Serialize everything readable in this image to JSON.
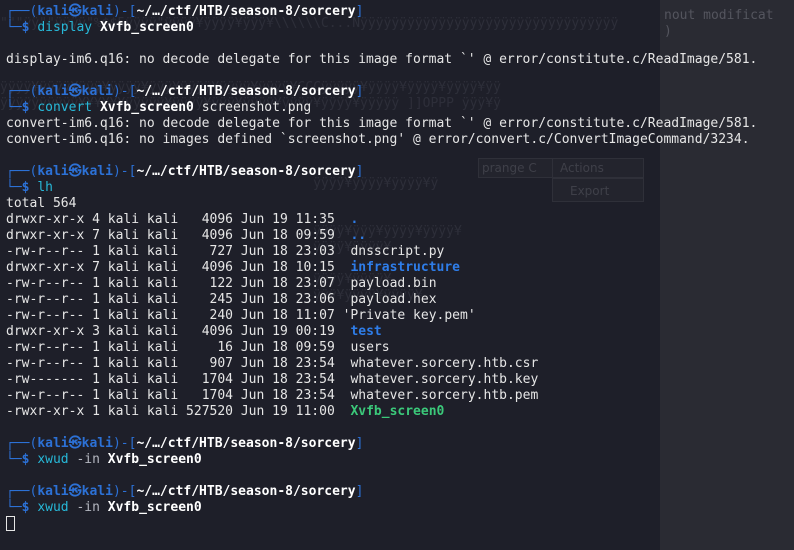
{
  "prompt": {
    "user": "kali",
    "host": "kali",
    "path": "~/…/ctf/HTB/season-8/sorcery",
    "symbol": "$"
  },
  "blocks": [
    {
      "command": "display",
      "args": [
        {
          "text": "Xvfb_screen0",
          "kind": "arg"
        }
      ],
      "output": [
        "",
        "display-im6.q16: no decode delegate for this image format `' @ error/constitute.c/ReadImage/581."
      ]
    },
    {
      "command": "convert",
      "args": [
        {
          "text": "Xvfb_screen0",
          "kind": "arg"
        },
        {
          "text": "screenshot.png",
          "kind": "plain"
        }
      ],
      "output": [
        "convert-im6.q16: no decode delegate for this image format `' @ error/constitute.c/ReadImage/581.",
        "convert-im6.q16: no images defined `screenshot.png' @ error/convert.c/ConvertImageCommand/3234."
      ]
    }
  ],
  "listing": {
    "command": "lh",
    "total": "total 564",
    "entries": [
      {
        "perms": "drwxr-xr-x",
        "links": "4",
        "owner": "kali",
        "group": "kali",
        "size": "4096",
        "month": "Jun",
        "day": "19",
        "time": "11:35",
        "name": ".",
        "kind": "dir"
      },
      {
        "perms": "drwxr-xr-x",
        "links": "7",
        "owner": "kali",
        "group": "kali",
        "size": "4096",
        "month": "Jun",
        "day": "18",
        "time": "09:59",
        "name": "..",
        "kind": "dir"
      },
      {
        "perms": "-rw-r--r--",
        "links": "1",
        "owner": "kali",
        "group": "kali",
        "size": "727",
        "month": "Jun",
        "day": "18",
        "time": "23:03",
        "name": "dnsscript.py",
        "kind": "file"
      },
      {
        "perms": "drwxr-xr-x",
        "links": "7",
        "owner": "kali",
        "group": "kali",
        "size": "4096",
        "month": "Jun",
        "day": "18",
        "time": "10:15",
        "name": "infrastructure",
        "kind": "dir"
      },
      {
        "perms": "-rw-r--r--",
        "links": "1",
        "owner": "kali",
        "group": "kali",
        "size": "122",
        "month": "Jun",
        "day": "18",
        "time": "23:07",
        "name": "payload.bin",
        "kind": "file"
      },
      {
        "perms": "-rw-r--r--",
        "links": "1",
        "owner": "kali",
        "group": "kali",
        "size": "245",
        "month": "Jun",
        "day": "18",
        "time": "23:06",
        "name": "payload.hex",
        "kind": "file"
      },
      {
        "perms": "-rw-r--r--",
        "links": "1",
        "owner": "kali",
        "group": "kali",
        "size": "240",
        "month": "Jun",
        "day": "18",
        "time": "11:07",
        "name": "'Private key.pem'",
        "kind": "quoted"
      },
      {
        "perms": "drwxr-xr-x",
        "links": "3",
        "owner": "kali",
        "group": "kali",
        "size": "4096",
        "month": "Jun",
        "day": "19",
        "time": "00:19",
        "name": "test",
        "kind": "dir"
      },
      {
        "perms": "-rw-r--r--",
        "links": "1",
        "owner": "kali",
        "group": "kali",
        "size": "16",
        "month": "Jun",
        "day": "18",
        "time": "09:59",
        "name": "users",
        "kind": "file"
      },
      {
        "perms": "-rw-r--r--",
        "links": "1",
        "owner": "kali",
        "group": "kali",
        "size": "907",
        "month": "Jun",
        "day": "18",
        "time": "23:54",
        "name": "whatever.sorcery.htb.csr",
        "kind": "file"
      },
      {
        "perms": "-rw-------",
        "links": "1",
        "owner": "kali",
        "group": "kali",
        "size": "1704",
        "month": "Jun",
        "day": "18",
        "time": "23:54",
        "name": "whatever.sorcery.htb.key",
        "kind": "file"
      },
      {
        "perms": "-rw-r--r--",
        "links": "1",
        "owner": "kali",
        "group": "kali",
        "size": "1704",
        "month": "Jun",
        "day": "18",
        "time": "23:54",
        "name": "whatever.sorcery.htb.pem",
        "kind": "file"
      },
      {
        "perms": "-rwxr-xr-x",
        "links": "1",
        "owner": "kali",
        "group": "kali",
        "size": "527520",
        "month": "Jun",
        "day": "19",
        "time": "11:00",
        "name": "Xvfb_screen0",
        "kind": "exe"
      }
    ]
  },
  "tail_blocks": [
    {
      "command": "xwud",
      "option": "-in",
      "arg": "Xvfb_screen0"
    },
    {
      "command": "xwud",
      "option": "-in",
      "arg": "Xvfb_screen0"
    }
  ],
  "background": {
    "right_text": "nout modificat",
    "right_sub": ")",
    "ghost_buttons": [
      "prange C",
      "Actions",
      "Export"
    ]
  },
  "colors": {
    "background": "#1e1f29",
    "prompt_frame": "#2c71d6",
    "directory": "#2e7de9",
    "executable": "#3bc97a",
    "command": "#27b8d8"
  }
}
